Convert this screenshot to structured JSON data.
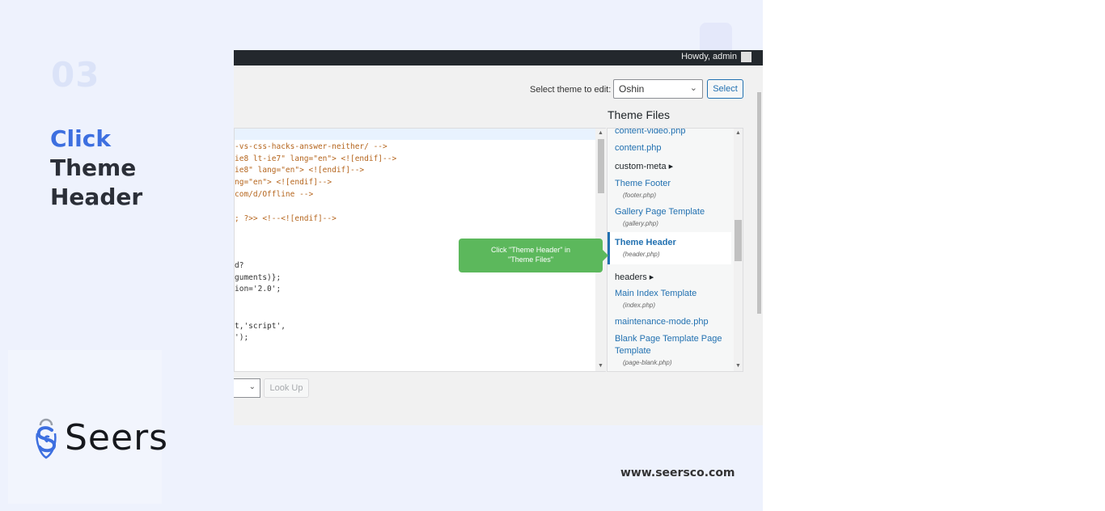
{
  "slide": {
    "step_number": "03",
    "title_highlight": "Click",
    "title_line2": "Theme",
    "title_line3": "Header",
    "brand_name": "Seers",
    "website": "www.seersco.com",
    "accent_color": "#3d6fe0"
  },
  "admin_bar": {
    "greeting": "Howdy, admin"
  },
  "theme_select": {
    "label": "Select theme to edit:",
    "value": "Oshin",
    "button_label": "Select"
  },
  "code_lines": [
    "-vs-css-hacks-answer-neither/ -->",
    "ie8 lt-ie7\" lang=\"en\"> <![endif]-->",
    "ie8\" lang=\"en\"> <![endif]-->",
    "ng=\"en\"> <![endif]-->",
    "com/d/Offline -->",
    "; ?>> <!--<![endif]-->",
    "d?",
    "guments)};",
    "ion='2.0';",
    "t,'script',",
    "');"
  ],
  "theme_files": {
    "title": "Theme Files",
    "items": [
      {
        "label": "content-video.php",
        "sub": ""
      },
      {
        "label": "content.php",
        "sub": ""
      },
      {
        "label": "custom-meta ▸",
        "sub": ""
      },
      {
        "label": "Theme Footer",
        "sub": "(footer.php)"
      },
      {
        "label": "Gallery Page Template",
        "sub": "(gallery.php)"
      },
      {
        "label": "Theme Header",
        "sub": "(header.php)"
      },
      {
        "label": "headers ▸",
        "sub": ""
      },
      {
        "label": "Main Index Template",
        "sub": "(index.php)"
      },
      {
        "label": "maintenance-mode.php",
        "sub": ""
      },
      {
        "label": "Blank Page Template Page",
        "sub": ""
      },
      {
        "label": "Template",
        "sub": "(page-blank.php)"
      }
    ]
  },
  "tooltip": {
    "line1": "Click \"Theme Header\" in",
    "line2": "\"Theme Files\""
  },
  "lookup": {
    "button_label": "Look Up"
  }
}
